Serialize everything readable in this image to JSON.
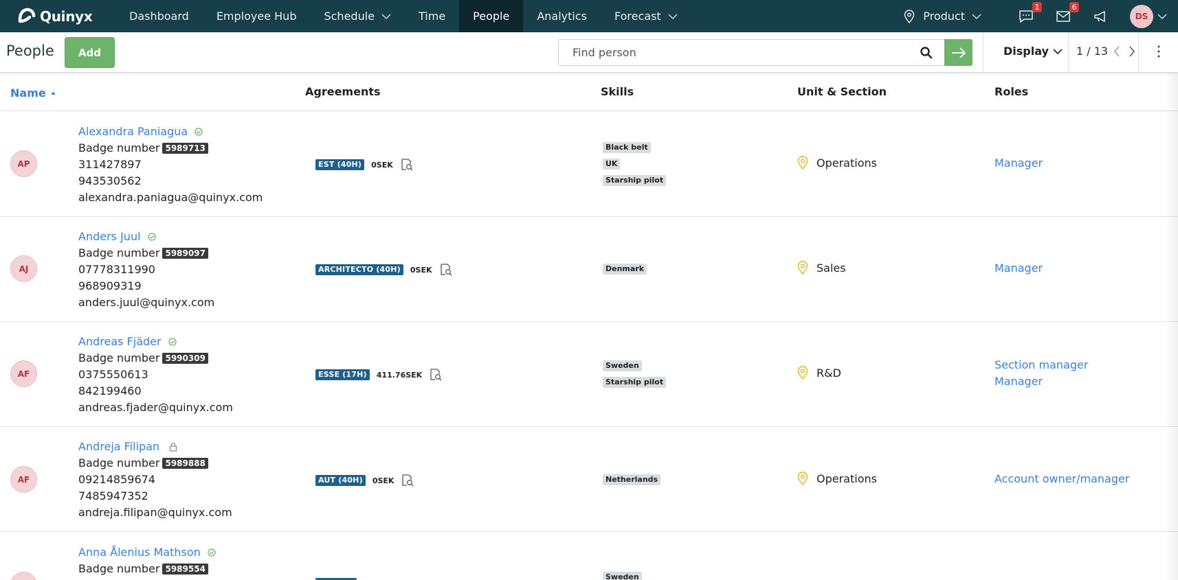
{
  "brand": {
    "name": "Quinyx"
  },
  "nav": {
    "items": [
      {
        "label": "Dashboard",
        "has_dropdown": false,
        "active": false
      },
      {
        "label": "Employee Hub",
        "has_dropdown": false,
        "active": false
      },
      {
        "label": "Schedule",
        "has_dropdown": true,
        "active": false
      },
      {
        "label": "Time",
        "has_dropdown": false,
        "active": false
      },
      {
        "label": "People",
        "has_dropdown": false,
        "active": true
      },
      {
        "label": "Analytics",
        "has_dropdown": false,
        "active": false
      },
      {
        "label": "Forecast",
        "has_dropdown": true,
        "active": false
      }
    ],
    "product_label": "Product",
    "messages_count": "1",
    "mail_count": "6",
    "user_initials": "DS"
  },
  "toolbar": {
    "title": "People",
    "add_label": "Add",
    "search_placeholder": "Find person",
    "display_label": "Display",
    "pager": "1 / 13"
  },
  "table": {
    "headers": {
      "name": "Name",
      "agreements": "Agreements",
      "skills": "Skills",
      "unit": "Unit & Section",
      "roles": "Roles"
    },
    "rows": [
      {
        "initials": "AP",
        "name": "Alexandra Paniagua",
        "status_icon": "check-circle-icon",
        "badge_label": "Badge number",
        "badge": "5989713",
        "phone1": "311427897",
        "phone2": "943530562",
        "email": "alexandra.paniagua@quinyx.com",
        "agreement": "EST (40H)",
        "salary": "0SEK",
        "skills": [
          "Black belt",
          "UK",
          "Starship pilot"
        ],
        "unit": "Operations",
        "roles": [
          "Manager"
        ]
      },
      {
        "initials": "AJ",
        "name": "Anders Juul",
        "status_icon": "check-circle-icon",
        "badge_label": "Badge number",
        "badge": "5989097",
        "phone1": "07778311990",
        "phone2": "968909319",
        "email": "anders.juul@quinyx.com",
        "agreement": "ARCHITECTO (40H)",
        "salary": "0SEK",
        "skills": [
          "Denmark"
        ],
        "unit": "Sales",
        "roles": [
          "Manager"
        ]
      },
      {
        "initials": "AF",
        "name": "Andreas Fjäder",
        "status_icon": "check-circle-icon",
        "badge_label": "Badge number",
        "badge": "5990309",
        "phone1": "0375550613",
        "phone2": "842199460",
        "email": "andreas.fjader@quinyx.com",
        "agreement": "ESSE (17H)",
        "salary": "411.76SEK",
        "skills": [
          "Sweden",
          "Starship pilot"
        ],
        "unit": "R&D",
        "roles": [
          "Section manager",
          "Manager"
        ]
      },
      {
        "initials": "AF",
        "name": "Andreja Filipan",
        "status_icon": "lock-icon",
        "badge_label": "Badge number",
        "badge": "5989888",
        "phone1": "09214859674",
        "phone2": "7485947352",
        "email": "andreja.filipan@quinyx.com",
        "agreement": "AUT (40H)",
        "salary": "0SEK",
        "skills": [
          "Netherlands"
        ],
        "unit": "Operations",
        "roles": [
          "Account owner/manager"
        ]
      },
      {
        "initials": "",
        "name": "Anna Ålenius Mathson",
        "status_icon": "check-circle-icon",
        "badge_label": "Badge number",
        "badge": "5989554",
        "phone1": "",
        "phone2": "",
        "email": "",
        "agreement": "",
        "salary": "",
        "skills": [
          "Sweden"
        ],
        "unit": "",
        "roles": []
      }
    ]
  },
  "colors": {
    "nav_bg": "#173f4a",
    "nav_active": "#0d262d",
    "accent_green": "#6db46a",
    "link_blue": "#3b7fd6",
    "agreement_tag": "#1f5f8b"
  }
}
